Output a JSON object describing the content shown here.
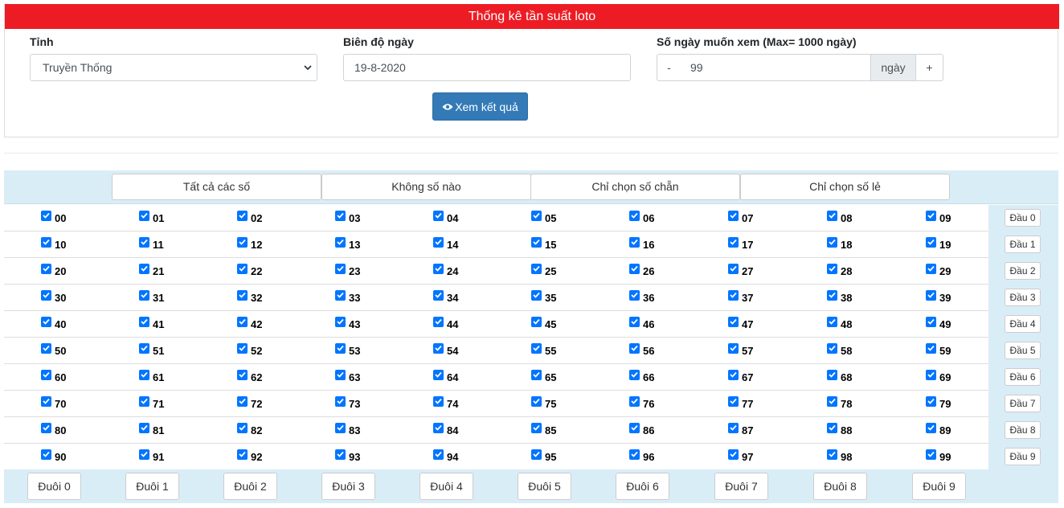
{
  "header": {
    "title": "Thống kê tần suất loto"
  },
  "form": {
    "province_label": "Tỉnh",
    "province_value": "Truyền Thống",
    "date_label": "Biên độ ngày",
    "date_value": "19-8-2020",
    "days_label": "Số ngày muốn xem (Max= 1000 ngày)",
    "minus_label": "-",
    "days_value": "99",
    "days_unit": "ngày",
    "plus_label": "+",
    "submit_label": "Xem kết quả",
    "submit_icon": "eye-icon"
  },
  "selectors": [
    "Tất cả các số",
    "Không số nào",
    "Chỉ chọn số chẵn",
    "Chỉ chọn số lẻ"
  ],
  "grid": {
    "checked": true,
    "numbers": [
      [
        "00",
        "01",
        "02",
        "03",
        "04",
        "05",
        "06",
        "07",
        "08",
        "09"
      ],
      [
        "10",
        "11",
        "12",
        "13",
        "14",
        "15",
        "16",
        "17",
        "18",
        "19"
      ],
      [
        "20",
        "21",
        "22",
        "23",
        "24",
        "25",
        "26",
        "27",
        "28",
        "29"
      ],
      [
        "30",
        "31",
        "32",
        "33",
        "34",
        "35",
        "36",
        "37",
        "38",
        "39"
      ],
      [
        "40",
        "41",
        "42",
        "43",
        "44",
        "45",
        "46",
        "47",
        "48",
        "49"
      ],
      [
        "50",
        "51",
        "52",
        "53",
        "54",
        "55",
        "56",
        "57",
        "58",
        "59"
      ],
      [
        "60",
        "61",
        "62",
        "63",
        "64",
        "65",
        "66",
        "67",
        "68",
        "69"
      ],
      [
        "70",
        "71",
        "72",
        "73",
        "74",
        "75",
        "76",
        "77",
        "78",
        "79"
      ],
      [
        "80",
        "81",
        "82",
        "83",
        "84",
        "85",
        "86",
        "87",
        "88",
        "89"
      ],
      [
        "90",
        "91",
        "92",
        "93",
        "94",
        "95",
        "96",
        "97",
        "98",
        "99"
      ]
    ],
    "head_buttons": [
      "Đầu 0",
      "Đầu 1",
      "Đầu 2",
      "Đầu 3",
      "Đầu 4",
      "Đầu 5",
      "Đầu 6",
      "Đầu 7",
      "Đầu 8",
      "Đầu 9"
    ],
    "tail_buttons": [
      "Đuôi 0",
      "Đuôi 1",
      "Đuôi 2",
      "Đuôi 3",
      "Đuôi 4",
      "Đuôi 5",
      "Đuôi 6",
      "Đuôi 7",
      "Đuôi 8",
      "Đuôi 9"
    ]
  },
  "colors": {
    "title_bar": "#ed1c24",
    "primary_button": "#337ab7",
    "strip": "#d9edf7",
    "checkbox": "#0075ff"
  }
}
